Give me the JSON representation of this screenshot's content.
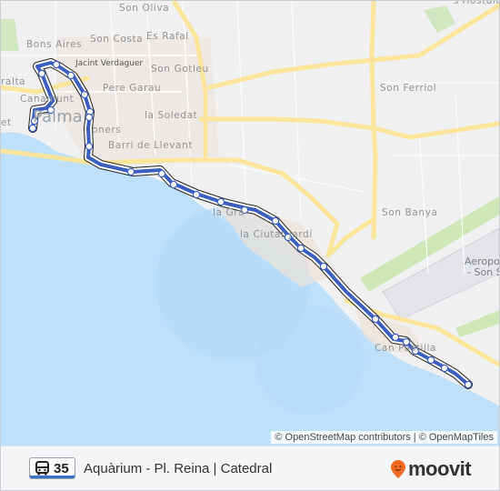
{
  "map": {
    "place_labels": [
      {
        "id": "son-oliva",
        "text": "Son Oliva"
      },
      {
        "id": "bons-aires",
        "text": "Bons Aires"
      },
      {
        "id": "son-costa",
        "text": "Son Costa"
      },
      {
        "id": "es-rafal",
        "text": "Es Rafal"
      },
      {
        "id": "jacint-verdaguer",
        "text": "Jacint Verdaguer"
      },
      {
        "id": "son-gotleu",
        "text": "Son Gotleu"
      },
      {
        "id": "pere-garau",
        "text": "Pere Garau"
      },
      {
        "id": "la-soledat",
        "text": "la Soledat"
      },
      {
        "id": "barri-de-llevant",
        "text": "Barri de Llevant"
      },
      {
        "id": "son-ferriol",
        "text": "Son Ferriol"
      },
      {
        "id": "son-banya",
        "text": "Son Banya"
      },
      {
        "id": "la-gran",
        "text": "la Gra"
      },
      {
        "id": "la-ciutat-jardi",
        "text": "la Ciutat Jardí"
      },
      {
        "id": "can-pastilla",
        "text": "Can Pastilla"
      },
      {
        "id": "aeroport-1",
        "text": "Aeropor"
      },
      {
        "id": "aeroport-2",
        "text": "- Son S"
      },
      {
        "id": "palma",
        "text": "Palma"
      },
      {
        "id": "canamunt",
        "text": "Canamunt"
      },
      {
        "id": "ralta",
        "text": "ralta"
      },
      {
        "id": "et",
        "text": "et"
      },
      {
        "id": "oners",
        "text": "oners"
      },
      {
        "id": "s-hostalot",
        "text": "s'Hostalot"
      }
    ],
    "attribution": "© OpenStreetMap contributors | © OpenMapTiles",
    "route_color": "#3a5fc0"
  },
  "footer": {
    "route_number": "35",
    "route_name": "Aquàrium - Pl. Reina | Catedral",
    "brand": "moovit",
    "brand_color": "#f26a21"
  }
}
